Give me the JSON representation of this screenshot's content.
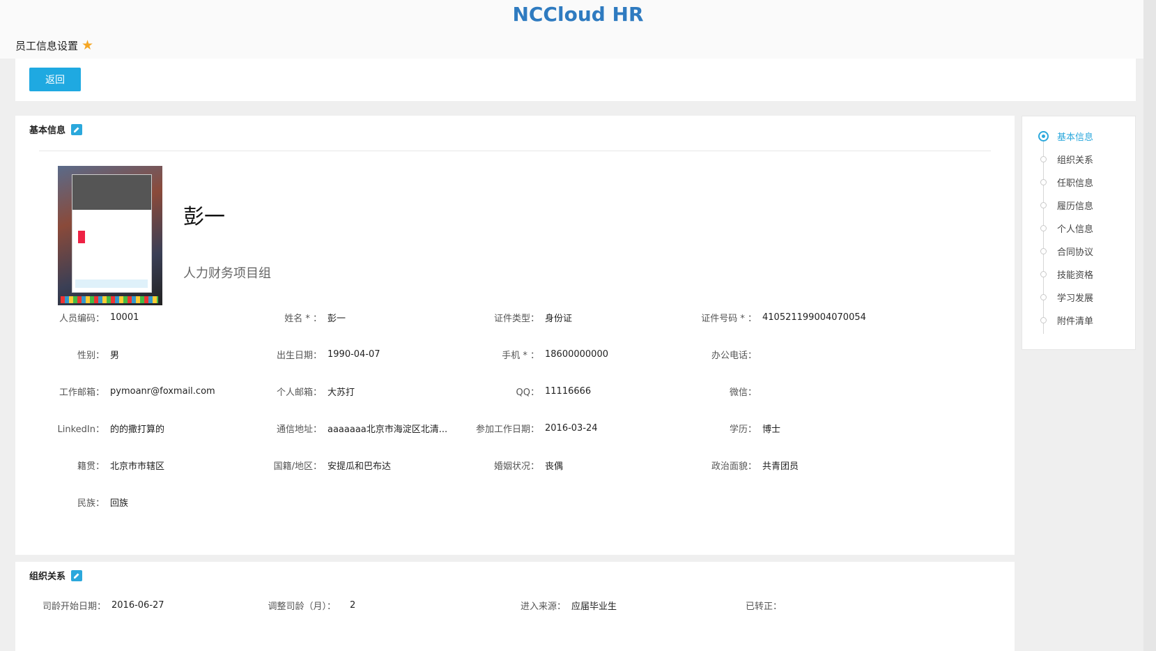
{
  "app_title": "NCCloud HR",
  "page_title": "员工信息设置",
  "toolbar": {
    "back_label": "返回"
  },
  "basic": {
    "section_title": "基本信息",
    "name": "彭一",
    "department": "人力财务项目组",
    "fields": [
      {
        "label": "人员编码：",
        "value": "10001"
      },
      {
        "label": "姓名 * ：",
        "value": "彭一"
      },
      {
        "label": "证件类型：",
        "value": "身份证"
      },
      {
        "label": "证件号码 * ：",
        "value": "410521199004070054"
      },
      {
        "label": "性别：",
        "value": "男"
      },
      {
        "label": "出生日期：",
        "value": "1990-04-07"
      },
      {
        "label": "手机 * ：",
        "value": "18600000000"
      },
      {
        "label": "办公电话：",
        "value": ""
      },
      {
        "label": "工作邮箱：",
        "value": "pymoanr@foxmail.com"
      },
      {
        "label": "个人邮箱：",
        "value": "大苏打"
      },
      {
        "label": "QQ：",
        "value": "11116666"
      },
      {
        "label": "微信：",
        "value": ""
      },
      {
        "label": "LinkedIn：",
        "value": "的的撒打算的"
      },
      {
        "label": "通信地址：",
        "value": "aaaaaaa北京市海淀区北清..."
      },
      {
        "label": "参加工作日期：",
        "value": "2016-03-24"
      },
      {
        "label": "学历：",
        "value": "博士"
      },
      {
        "label": "籍贯：",
        "value": "北京市市辖区"
      },
      {
        "label": "国籍/地区：",
        "value": "安提瓜和巴布达"
      },
      {
        "label": "婚姻状况：",
        "value": "丧偶"
      },
      {
        "label": "政治面貌：",
        "value": "共青团员"
      },
      {
        "label": "民族：",
        "value": "回族"
      }
    ]
  },
  "org": {
    "section_title": "组织关系",
    "fields": [
      {
        "label": "司龄开始日期：",
        "value": "2016-06-27"
      },
      {
        "label": "调整司龄（月）：",
        "value": "2"
      },
      {
        "label": "进入来源：",
        "value": "应届毕业生"
      },
      {
        "label": "已转正：",
        "value": ""
      }
    ]
  },
  "nav": {
    "items": [
      {
        "label": "基本信息",
        "active": true
      },
      {
        "label": "组织关系",
        "active": false
      },
      {
        "label": "任职信息",
        "active": false
      },
      {
        "label": "履历信息",
        "active": false
      },
      {
        "label": "个人信息",
        "active": false
      },
      {
        "label": "合同协议",
        "active": false
      },
      {
        "label": "技能资格",
        "active": false
      },
      {
        "label": "学习发展",
        "active": false
      },
      {
        "label": "附件清单",
        "active": false
      }
    ]
  },
  "colors": {
    "accent": "#2ba8dc",
    "button": "#1fa9e1",
    "title": "#2f7bc0",
    "star": "#f5a623"
  }
}
